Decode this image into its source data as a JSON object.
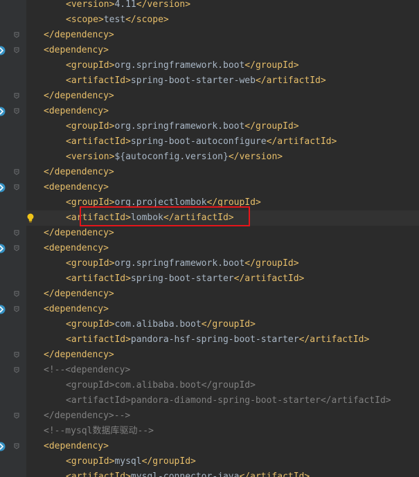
{
  "lines": [
    {
      "indent": 2,
      "parts": [
        {
          "k": "t",
          "s": "<version>"
        },
        {
          "k": "v",
          "s": "4.11"
        },
        {
          "k": "t",
          "s": "</version>"
        }
      ]
    },
    {
      "indent": 2,
      "parts": [
        {
          "k": "t",
          "s": "<scope>"
        },
        {
          "k": "v",
          "s": "test"
        },
        {
          "k": "t",
          "s": "</scope>"
        }
      ]
    },
    {
      "indent": 1,
      "parts": [
        {
          "k": "t",
          "s": "</dependency>"
        }
      ]
    },
    {
      "indent": 1,
      "parts": [
        {
          "k": "t",
          "s": "<dependency>"
        }
      ]
    },
    {
      "indent": 2,
      "parts": [
        {
          "k": "t",
          "s": "<groupId>"
        },
        {
          "k": "v",
          "s": "org.springframework.boot"
        },
        {
          "k": "t",
          "s": "</groupId>"
        }
      ]
    },
    {
      "indent": 2,
      "parts": [
        {
          "k": "t",
          "s": "<artifactId>"
        },
        {
          "k": "v",
          "s": "spring-boot-starter-web"
        },
        {
          "k": "t",
          "s": "</artifactId>"
        }
      ]
    },
    {
      "indent": 1,
      "parts": [
        {
          "k": "t",
          "s": "</dependency>"
        }
      ]
    },
    {
      "indent": 1,
      "parts": [
        {
          "k": "t",
          "s": "<dependency>"
        }
      ]
    },
    {
      "indent": 2,
      "parts": [
        {
          "k": "t",
          "s": "<groupId>"
        },
        {
          "k": "v",
          "s": "org.springframework.boot"
        },
        {
          "k": "t",
          "s": "</groupId>"
        }
      ]
    },
    {
      "indent": 2,
      "parts": [
        {
          "k": "t",
          "s": "<artifactId>"
        },
        {
          "k": "v",
          "s": "spring-boot-autoconfigure"
        },
        {
          "k": "t",
          "s": "</artifactId>"
        }
      ]
    },
    {
      "indent": 2,
      "parts": [
        {
          "k": "t",
          "s": "<version>"
        },
        {
          "k": "v",
          "s": "${autoconfig.version}"
        },
        {
          "k": "t",
          "s": "</version>"
        }
      ]
    },
    {
      "indent": 1,
      "parts": [
        {
          "k": "t",
          "s": "</dependency>"
        }
      ]
    },
    {
      "indent": 1,
      "parts": [
        {
          "k": "t",
          "s": "<dependency>"
        }
      ]
    },
    {
      "indent": 2,
      "parts": [
        {
          "k": "t",
          "s": "<groupId>"
        },
        {
          "k": "v",
          "s": "org.projectlombok"
        },
        {
          "k": "t",
          "s": "</groupId>"
        }
      ]
    },
    {
      "indent": 2,
      "parts": [
        {
          "k": "t",
          "s": "<artifactId>"
        },
        {
          "k": "v",
          "s": "lombok"
        },
        {
          "k": "t",
          "s": "</artifactId>"
        }
      ]
    },
    {
      "indent": 1,
      "parts": [
        {
          "k": "t",
          "s": "</dependency>"
        }
      ]
    },
    {
      "indent": 1,
      "parts": [
        {
          "k": "t",
          "s": "<dependency>"
        }
      ]
    },
    {
      "indent": 2,
      "parts": [
        {
          "k": "t",
          "s": "<groupId>"
        },
        {
          "k": "v",
          "s": "org.springframework.boot"
        },
        {
          "k": "t",
          "s": "</groupId>"
        }
      ]
    },
    {
      "indent": 2,
      "parts": [
        {
          "k": "t",
          "s": "<artifactId>"
        },
        {
          "k": "v",
          "s": "spring-boot-starter"
        },
        {
          "k": "t",
          "s": "</artifactId>"
        }
      ]
    },
    {
      "indent": 1,
      "parts": [
        {
          "k": "t",
          "s": "</dependency>"
        }
      ]
    },
    {
      "indent": 1,
      "parts": [
        {
          "k": "t",
          "s": "<dependency>"
        }
      ]
    },
    {
      "indent": 2,
      "parts": [
        {
          "k": "t",
          "s": "<groupId>"
        },
        {
          "k": "v",
          "s": "com.alibaba.boot"
        },
        {
          "k": "t",
          "s": "</groupId>"
        }
      ]
    },
    {
      "indent": 2,
      "parts": [
        {
          "k": "t",
          "s": "<artifactId>"
        },
        {
          "k": "v",
          "s": "pandora-hsf-spring-boot-starter"
        },
        {
          "k": "t",
          "s": "</artifactId>"
        }
      ]
    },
    {
      "indent": 1,
      "parts": [
        {
          "k": "t",
          "s": "</dependency>"
        }
      ]
    },
    {
      "indent": 1,
      "parts": [
        {
          "k": "c",
          "s": "<!--<dependency>"
        }
      ]
    },
    {
      "indent": 2,
      "parts": [
        {
          "k": "c",
          "s": "<groupId>com.alibaba.boot</groupId>"
        }
      ]
    },
    {
      "indent": 2,
      "parts": [
        {
          "k": "c",
          "s": "<artifactId>pandora-diamond-spring-boot-starter</artifactId>"
        }
      ]
    },
    {
      "indent": 1,
      "parts": [
        {
          "k": "c",
          "s": "</dependency>-->"
        }
      ]
    },
    {
      "indent": 1,
      "parts": [
        {
          "k": "c",
          "s": "<!--mysql数据库驱动-->"
        }
      ]
    },
    {
      "indent": 1,
      "parts": [
        {
          "k": "t",
          "s": "<dependency>"
        }
      ]
    },
    {
      "indent": 2,
      "parts": [
        {
          "k": "t",
          "s": "<groupId>"
        },
        {
          "k": "v",
          "s": "mysql"
        },
        {
          "k": "t",
          "s": "</groupId>"
        }
      ]
    },
    {
      "indent": 2,
      "parts": [
        {
          "k": "t",
          "s": "<artifactId>"
        },
        {
          "k": "v",
          "s": "mysql-connector-java"
        },
        {
          "k": "t",
          "s": "</artifactId>"
        }
      ]
    }
  ],
  "gutter": {
    "fold_lines": [
      2,
      3,
      6,
      7,
      11,
      12,
      15,
      16,
      19,
      20,
      23,
      24,
      27,
      29
    ],
    "run_icon_lines": [
      3,
      7,
      12,
      16,
      20,
      29
    ],
    "bulb_line": 14
  },
  "highlight_line": 14,
  "colors": {
    "background": "#2b2b2b",
    "gutter": "#313335",
    "tag": "#e8bf6a",
    "text": "#a9b7c6",
    "comment": "#808080",
    "highlight_border": "#e5151a",
    "run_icon": "#3592c4",
    "bulb": "#f0c419"
  }
}
